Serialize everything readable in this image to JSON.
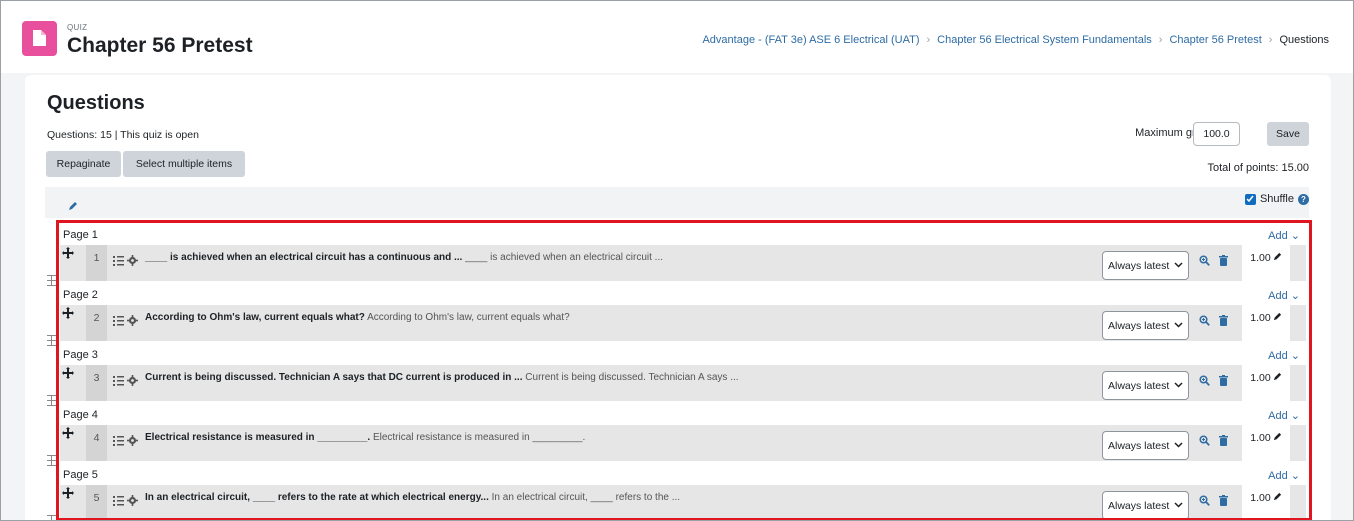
{
  "header": {
    "module_type": "QUIZ",
    "title": "Chapter 56 Pretest",
    "breadcrumb": [
      "Advantage - (FAT 3e) ASE 6 Electrical (UAT)",
      "Chapter 56 Electrical System Fundamentals",
      "Chapter 56 Pretest",
      "Questions"
    ]
  },
  "main": {
    "heading": "Questions",
    "status": "Questions: 15 | This quiz is open",
    "buttons": {
      "repaginate": "Repaginate",
      "select_multiple": "Select multiple items",
      "save": "Save"
    },
    "max_grade_label": "Maximum grade",
    "max_grade_value": "100.0",
    "total_points": "Total of points: 15.00",
    "shuffle_label": "Shuffle"
  },
  "pages": [
    {
      "label": "Page 1",
      "add": "Add",
      "question": {
        "num": "1",
        "bold": "____ is achieved when an electrical circuit has a continuous and ...",
        "plain": "____ is achieved when an electrical circuit ...",
        "version": "Always latest",
        "mark": "1.00"
      }
    },
    {
      "label": "Page 2",
      "add": "Add",
      "question": {
        "num": "2",
        "bold": "According to Ohm's law, current equals what?",
        "plain": "According to Ohm's law, current equals what?",
        "version": "Always latest",
        "mark": "1.00"
      }
    },
    {
      "label": "Page 3",
      "add": "Add",
      "question": {
        "num": "3",
        "bold": "Current is being discussed. Technician A says that DC current is produced in ...",
        "plain": "Current is being discussed. Technician A says ...",
        "version": "Always latest",
        "mark": "1.00"
      }
    },
    {
      "label": "Page 4",
      "add": "Add",
      "question": {
        "num": "4",
        "bold": "Electrical resistance is measured in _________.",
        "plain": "Electrical resistance is measured in _________.",
        "version": "Always latest",
        "mark": "1.00"
      }
    },
    {
      "label": "Page 5",
      "add": "Add",
      "question": {
        "num": "5",
        "bold": "In an electrical circuit, ____ refers to the rate at which electrical energy...",
        "plain": "In an electrical circuit, ____ refers to the ...",
        "version": "Always latest",
        "mark": "1.00"
      }
    }
  ],
  "colors": {
    "module_icon": "#e84f9c",
    "link": "#2e6ca4",
    "highlight": "#e0151f",
    "button": "#ced4da"
  }
}
